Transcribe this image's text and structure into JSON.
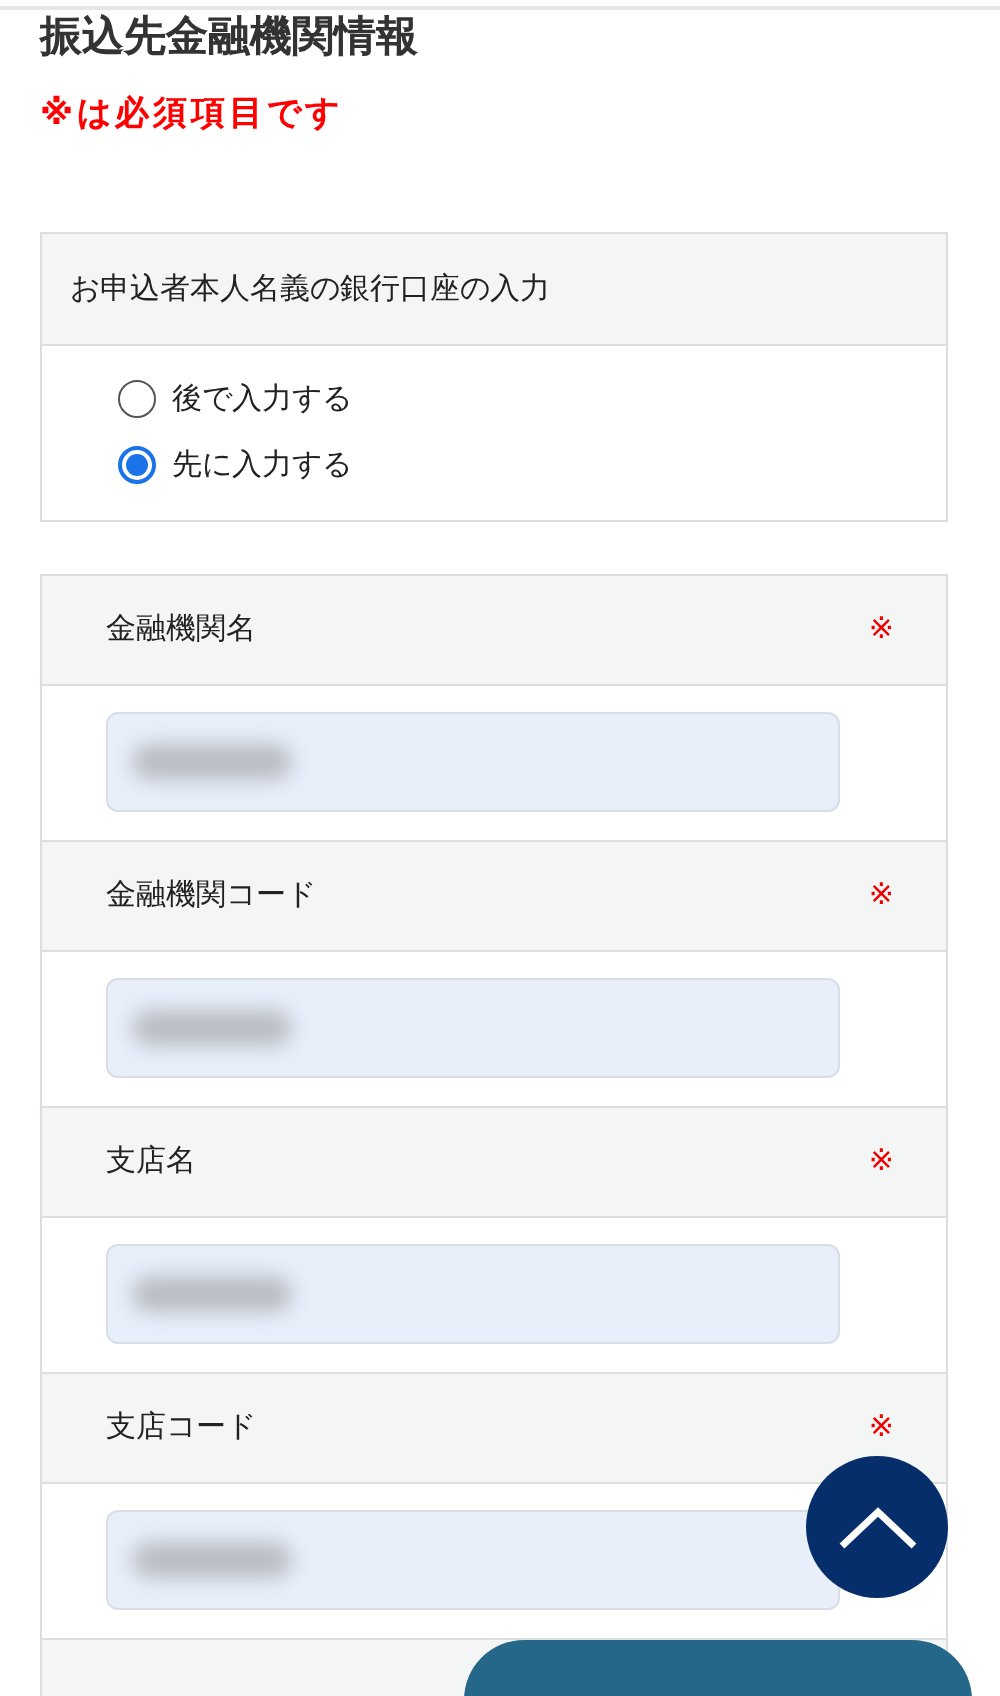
{
  "page_title": "振込先金融機関情報",
  "required_note": "※は必須項目です",
  "account_input": {
    "heading": "お申込者本人名義の銀行口座の入力",
    "options": [
      {
        "label": "後で入力する",
        "selected": false
      },
      {
        "label": "先に入力する",
        "selected": true
      }
    ]
  },
  "fields": [
    {
      "label": "金融機関名",
      "required_mark": "※",
      "redacted": true
    },
    {
      "label": "金融機関コード",
      "required_mark": "※",
      "redacted": true
    },
    {
      "label": "支店名",
      "required_mark": "※",
      "redacted": true
    },
    {
      "label": "支店コード",
      "required_mark": "※",
      "redacted": true
    }
  ]
}
